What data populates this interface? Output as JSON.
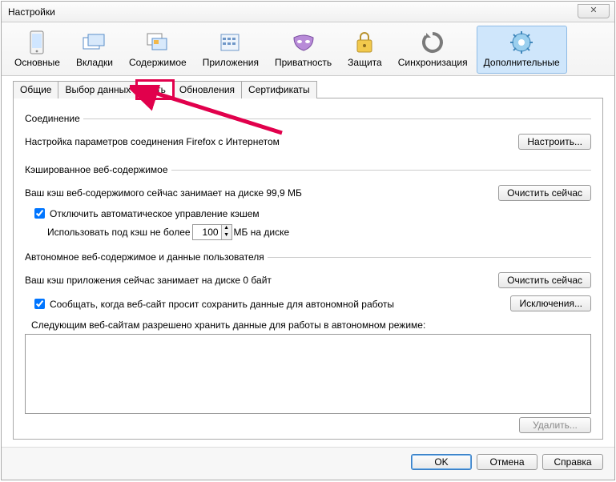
{
  "window": {
    "title": "Настройки"
  },
  "toolbar": {
    "items": [
      {
        "label": "Основные"
      },
      {
        "label": "Вкладки"
      },
      {
        "label": "Содержимое"
      },
      {
        "label": "Приложения"
      },
      {
        "label": "Приватность"
      },
      {
        "label": "Защита"
      },
      {
        "label": "Синхронизация"
      },
      {
        "label": "Дополнительные"
      }
    ]
  },
  "subtabs": {
    "items": [
      {
        "label": "Общие"
      },
      {
        "label": "Выбор данных"
      },
      {
        "label": "Сеть"
      },
      {
        "label": "Обновления"
      },
      {
        "label": "Сертификаты"
      }
    ]
  },
  "connection": {
    "legend": "Соединение",
    "desc": "Настройка параметров соединения Firefox с Интернетом",
    "configure": "Настроить..."
  },
  "cache": {
    "legend": "Кэшированное веб-содержимое",
    "status": "Ваш кэш веб-содержимого сейчас занимает на диске 99,9 МБ",
    "clear": "Очистить сейчас",
    "checkbox": "Отключить автоматическое управление кэшем",
    "limit_prefix": "Использовать под кэш не более",
    "limit_value": "100",
    "limit_suffix": "МБ на диске"
  },
  "offline": {
    "legend": "Автономное веб-содержимое и данные пользователя",
    "status": "Ваш кэш приложения сейчас занимает на диске 0 байт",
    "clear": "Очистить сейчас",
    "checkbox": "Сообщать, когда веб-сайт просит сохранить данные для автономной работы",
    "exceptions": "Исключения...",
    "list_label": "Следующим веб-сайтам разрешено хранить данные для работы в автономном режиме:",
    "delete": "Удалить..."
  },
  "footer": {
    "ok": "OK",
    "cancel": "Отмена",
    "help": "Справка"
  }
}
